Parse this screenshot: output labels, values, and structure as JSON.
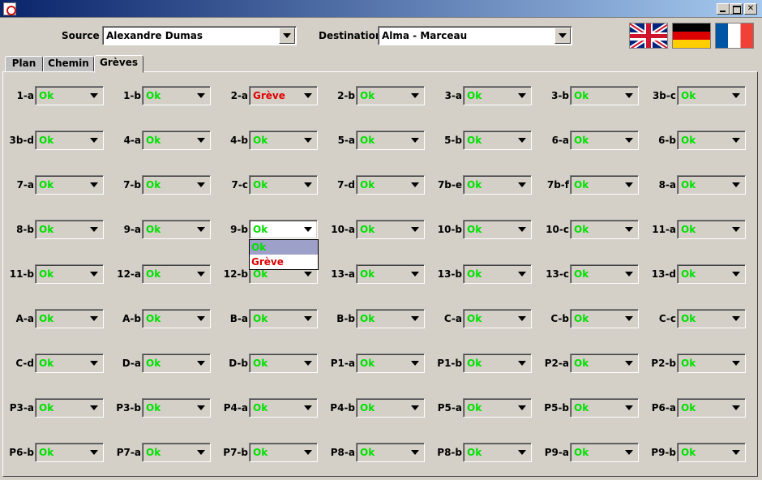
{
  "window": {
    "title": ""
  },
  "top": {
    "source_label": "Source",
    "source_value": "Alexandre Dumas",
    "destination_label": "Destination",
    "destination_value": "Alma - Marceau"
  },
  "flags": [
    "uk-flag",
    "germany-flag",
    "france-flag"
  ],
  "tabs": [
    {
      "label": "Plan",
      "active": false
    },
    {
      "label": "Chemin",
      "active": false
    },
    {
      "label": "Grèves",
      "active": true
    }
  ],
  "colors": {
    "ok": "#00e000",
    "greve": "#e00000"
  },
  "grid": [
    [
      [
        "1-a",
        "Ok"
      ],
      [
        "1-b",
        "Ok"
      ],
      [
        "2-a",
        "Grève"
      ],
      [
        "2-b",
        "Ok"
      ],
      [
        "3-a",
        "Ok"
      ],
      [
        "3-b",
        "Ok"
      ],
      [
        "3b-c",
        "Ok"
      ]
    ],
    [
      [
        "3b-d",
        "Ok"
      ],
      [
        "4-a",
        "Ok"
      ],
      [
        "4-b",
        "Ok"
      ],
      [
        "5-a",
        "Ok"
      ],
      [
        "5-b",
        "Ok"
      ],
      [
        "6-a",
        "Ok"
      ],
      [
        "6-b",
        "Ok"
      ]
    ],
    [
      [
        "7-a",
        "Ok"
      ],
      [
        "7-b",
        "Ok"
      ],
      [
        "7-c",
        "Ok"
      ],
      [
        "7-d",
        "Ok"
      ],
      [
        "7b-e",
        "Ok"
      ],
      [
        "7b-f",
        "Ok"
      ],
      [
        "8-a",
        "Ok"
      ]
    ],
    [
      [
        "8-b",
        "Ok"
      ],
      [
        "9-a",
        "Ok"
      ],
      [
        "9-b",
        "Ok"
      ],
      [
        "10-a",
        "Ok"
      ],
      [
        "10-b",
        "Ok"
      ],
      [
        "10-c",
        "Ok"
      ],
      [
        "11-a",
        "Ok"
      ]
    ],
    [
      [
        "11-b",
        "Ok"
      ],
      [
        "12-a",
        "Ok"
      ],
      [
        "12-b",
        "Ok"
      ],
      [
        "13-a",
        "Ok"
      ],
      [
        "13-b",
        "Ok"
      ],
      [
        "13-c",
        "Ok"
      ],
      [
        "13-d",
        "Ok"
      ]
    ],
    [
      [
        "A-a",
        "Ok"
      ],
      [
        "A-b",
        "Ok"
      ],
      [
        "B-a",
        "Ok"
      ],
      [
        "B-b",
        "Ok"
      ],
      [
        "C-a",
        "Ok"
      ],
      [
        "C-b",
        "Ok"
      ],
      [
        "C-c",
        "Ok"
      ]
    ],
    [
      [
        "C-d",
        "Ok"
      ],
      [
        "D-a",
        "Ok"
      ],
      [
        "D-b",
        "Ok"
      ],
      [
        "P1-a",
        "Ok"
      ],
      [
        "P1-b",
        "Ok"
      ],
      [
        "P2-a",
        "Ok"
      ],
      [
        "P2-b",
        "Ok"
      ]
    ],
    [
      [
        "P3-a",
        "Ok"
      ],
      [
        "P3-b",
        "Ok"
      ],
      [
        "P4-a",
        "Ok"
      ],
      [
        "P4-b",
        "Ok"
      ],
      [
        "P5-a",
        "Ok"
      ],
      [
        "P5-b",
        "Ok"
      ],
      [
        "P6-a",
        "Ok"
      ]
    ],
    [
      [
        "P6-b",
        "Ok"
      ],
      [
        "P7-a",
        "Ok"
      ],
      [
        "P7-b",
        "Ok"
      ],
      [
        "P8-a",
        "Ok"
      ],
      [
        "P8-b",
        "Ok"
      ],
      [
        "P9-a",
        "Ok"
      ],
      [
        "P9-b",
        "Ok"
      ]
    ]
  ],
  "open_dropdown": {
    "cell": "9-b",
    "options": [
      "Ok",
      "Grève"
    ]
  }
}
